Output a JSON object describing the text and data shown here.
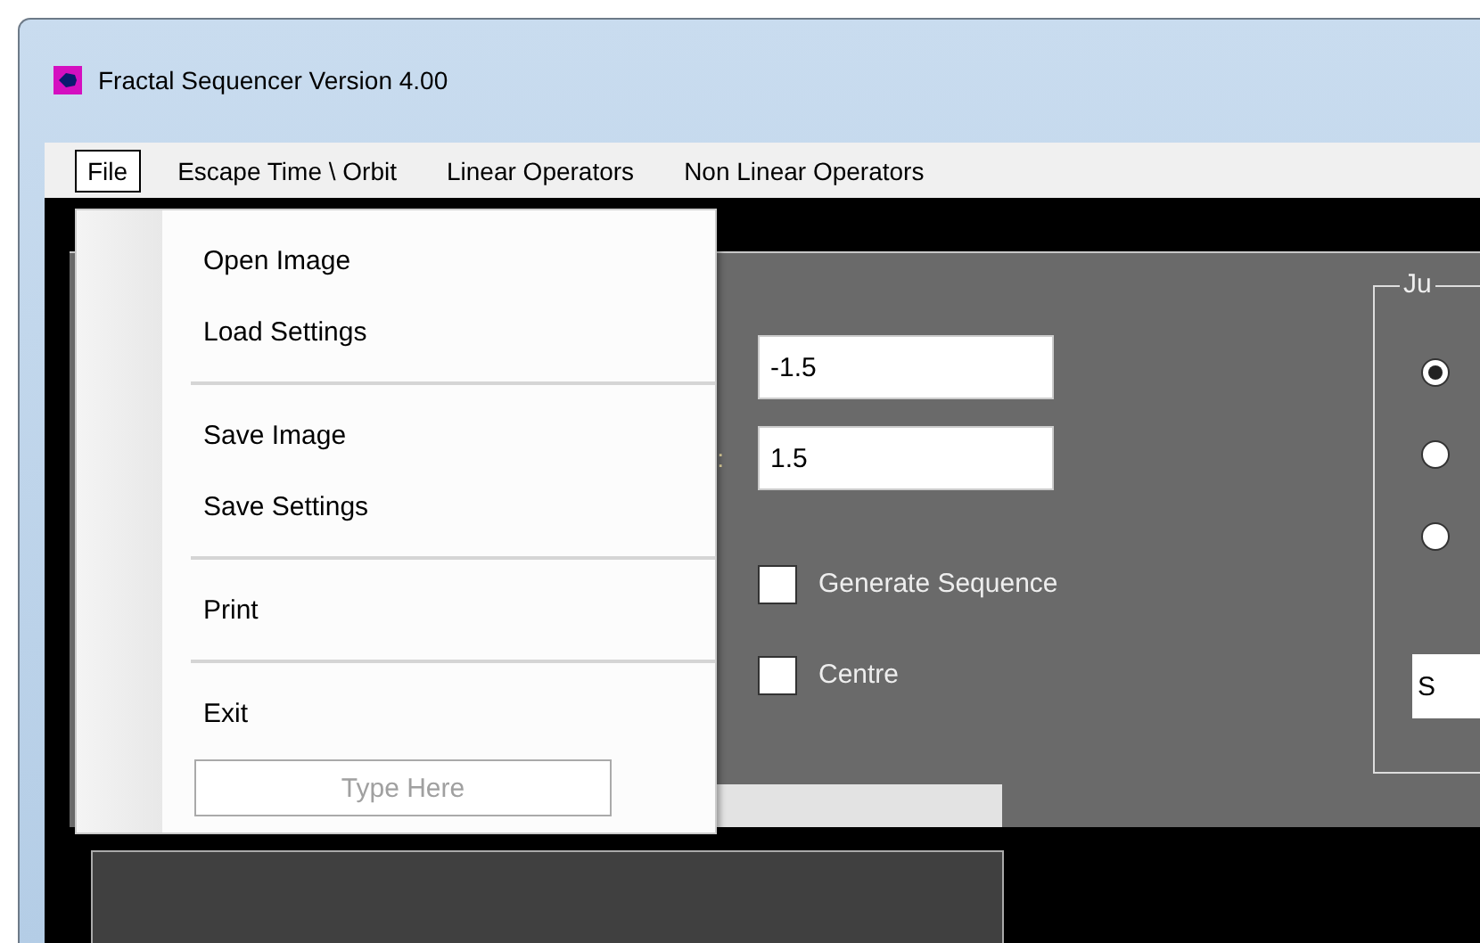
{
  "window": {
    "title": "Fractal Sequencer Version 4.00"
  },
  "menu_bar": [
    {
      "label": "File",
      "selected": true
    },
    {
      "label": "Escape Time \\ Orbit",
      "selected": false
    },
    {
      "label": "Linear Operators",
      "selected": false
    },
    {
      "label": "Non Linear Operators",
      "selected": false
    }
  ],
  "file_menu": [
    {
      "kind": "item",
      "label": "Open Image"
    },
    {
      "kind": "item",
      "label": "Load Settings"
    },
    {
      "kind": "separator"
    },
    {
      "kind": "item",
      "label": "Save Image"
    },
    {
      "kind": "item",
      "label": "Save Settings"
    },
    {
      "kind": "separator"
    },
    {
      "kind": "item",
      "label": "Print"
    },
    {
      "kind": "separator"
    },
    {
      "kind": "item",
      "label": "Exit"
    },
    {
      "kind": "input",
      "placeholder": "Type Here"
    }
  ],
  "panel": {
    "fields": [
      {
        "value": "-1.5"
      },
      {
        "label": ":",
        "value": "1.5"
      }
    ],
    "checkboxes": [
      {
        "label": "Generate Sequence",
        "checked": false
      },
      {
        "label": "Centre",
        "checked": false
      }
    ],
    "progress": {
      "level": 0
    },
    "group": {
      "title": "Ju",
      "options": [
        {
          "selected": true
        },
        {
          "selected": false
        },
        {
          "selected": false
        }
      ],
      "field": {
        "value": "S"
      }
    }
  }
}
